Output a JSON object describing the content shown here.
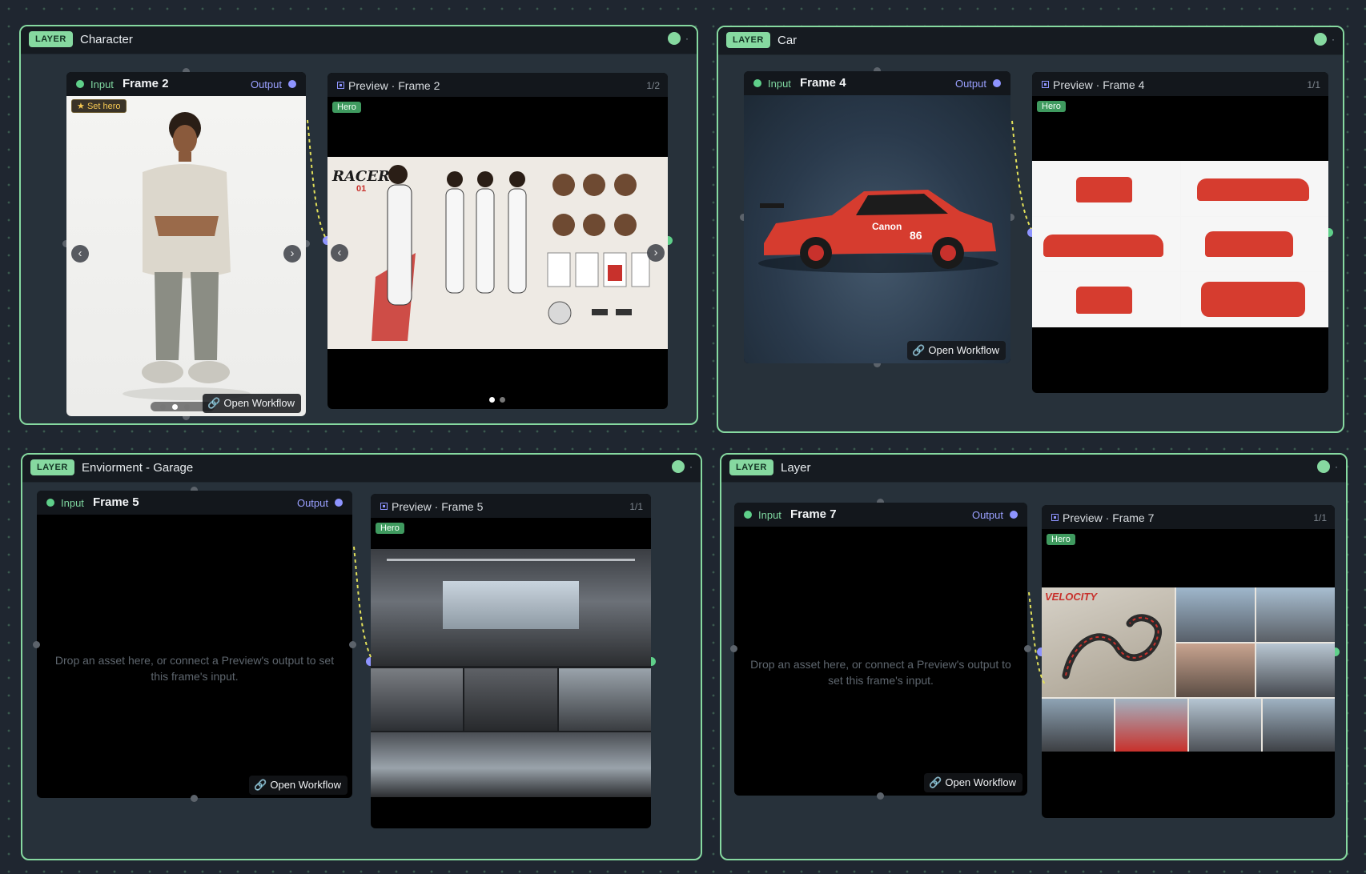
{
  "layers": [
    {
      "badge": "LAYER",
      "title": "Character",
      "input": {
        "label": "Input",
        "frame": "Frame 2",
        "output": "Output",
        "set_hero": "Set hero",
        "open_workflow": "Open Workflow"
      },
      "preview": {
        "title": "Preview · Frame 2",
        "count": "1/2",
        "hero": "Hero",
        "image_page": 1,
        "image_pages": 2
      }
    },
    {
      "badge": "LAYER",
      "title": "Car",
      "input": {
        "label": "Input",
        "frame": "Frame 4",
        "output": "Output",
        "open_workflow": "Open Workflow"
      },
      "preview": {
        "title": "Preview · Frame 4",
        "count": "1/1",
        "hero": "Hero"
      }
    },
    {
      "badge": "LAYER",
      "title": "Enviorment - Garage",
      "input": {
        "label": "Input",
        "frame": "Frame 5",
        "output": "Output",
        "placeholder": "Drop an asset here, or connect a Preview's output to set this frame's input.",
        "open_workflow": "Open Workflow"
      },
      "preview": {
        "title": "Preview · Frame 5",
        "count": "1/1",
        "hero": "Hero"
      }
    },
    {
      "badge": "LAYER",
      "title": "Layer",
      "input": {
        "label": "Input",
        "frame": "Frame 7",
        "output": "Output",
        "placeholder": "Drop an asset here, or connect a Preview's output to set this frame's input.",
        "open_workflow": "Open Workflow"
      },
      "preview": {
        "title": "Preview · Frame 7",
        "count": "1/1",
        "hero": "Hero"
      }
    }
  ],
  "artwork": {
    "racer_sheet_logo": "RACER",
    "racer_sheet_number": "01",
    "car_number": "86",
    "car_sponsor": "Canon",
    "track_logo": "VELOCITY"
  },
  "icons": {
    "link": "link-icon",
    "star": "star-icon",
    "prev": "chevron-left-icon",
    "next": "chevron-right-icon"
  },
  "colors": {
    "layer_border": "#86d9a0",
    "badge_bg": "#86d9a0",
    "input_dot": "#5fd08a",
    "output_dot": "#8e94ff",
    "hero_badge": "#3f9a5f",
    "wire": "#e2e05a",
    "canvas": "#1f2630"
  }
}
